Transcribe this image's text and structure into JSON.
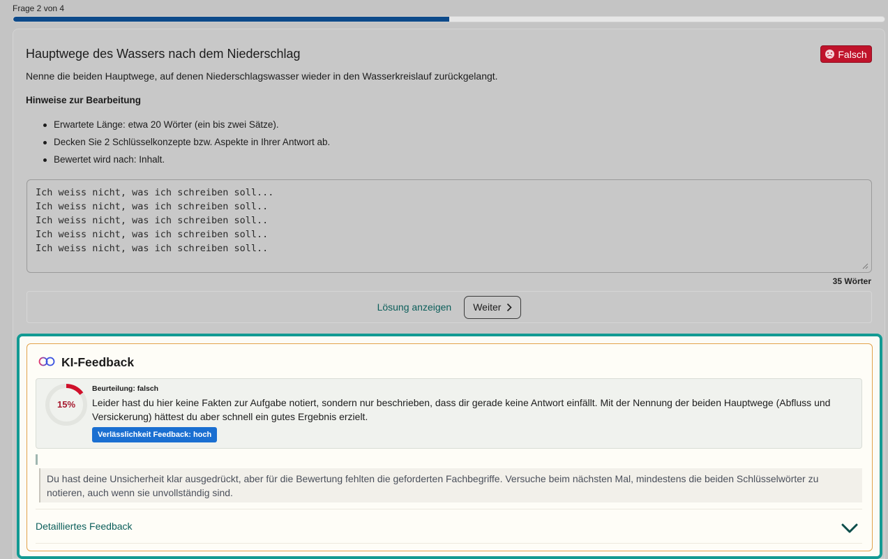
{
  "progress": {
    "label": "Frage 2 von 4",
    "fraction": 0.5,
    "fill_color": "#0d4a8a"
  },
  "question": {
    "title": "Hauptwege des Wassers nach dem Niederschlag",
    "status_badge": "Falsch",
    "status_color": "#c0132b",
    "text": "Nenne die beiden Hauptwege, auf denen Niederschlagswasser wieder in den Wasserkreislauf zurückgelangt.",
    "hints_heading": "Hinweise zur Bearbeitung",
    "hints": [
      "Erwartete Länge: etwa 20 Wörter (ein bis zwei Sätze).",
      "Decken Sie 2 Schlüsselkonzepte bzw. Aspekte in Ihrer Antwort ab.",
      "Bewertet wird nach: Inhalt."
    ]
  },
  "answer": {
    "text": "Ich weiss nicht, was ich schreiben soll...\nIch weiss nicht, was ich schreiben soll..\nIch weiss nicht, was ich schreiben soll..\nIch weiss nicht, was ich schreiben soll..\nIch weiss nicht, was ich schreiben soll..",
    "word_count": "35 Wörter"
  },
  "actions": {
    "show_solution": "Lösung anzeigen",
    "next": "Weiter"
  },
  "feedback": {
    "title": "KI-Feedback",
    "score_label": "15%",
    "score_fraction": 0.15,
    "score_color": "#d0102a",
    "assessment_label": "Beurteilung: falsch",
    "assessment_text": "Leider hast du hier keine Fakten zur Aufgabe notiert, sondern nur beschrieben, dass dir gerade keine Antwort einfällt. Mit der Nennung der beiden Hauptwege (Abfluss und Versickerung) hättest du aber schnell ein gutes Ergebnis erzielt.",
    "reliability_badge": "Verlässlichkeit Feedback: hoch",
    "reliability_color": "#1a6fd1",
    "quote": "Du hast deine Unsicherheit klar ausgedrückt, aber für die Bewertung fehlten die geforderten Fachbegriffe. Versuche beim nächsten Mal, mindestens die beiden Schlüsselwörter zu notieren, auch wenn sie unvollständig sind.",
    "detail_label": "Detailliertes Feedback",
    "accent_color": "#129a93"
  },
  "icons": {
    "status": "frown-icon",
    "next": "chevron-right-icon",
    "ai_logo": "linked-rings-icon",
    "expand": "chevron-down-icon"
  }
}
